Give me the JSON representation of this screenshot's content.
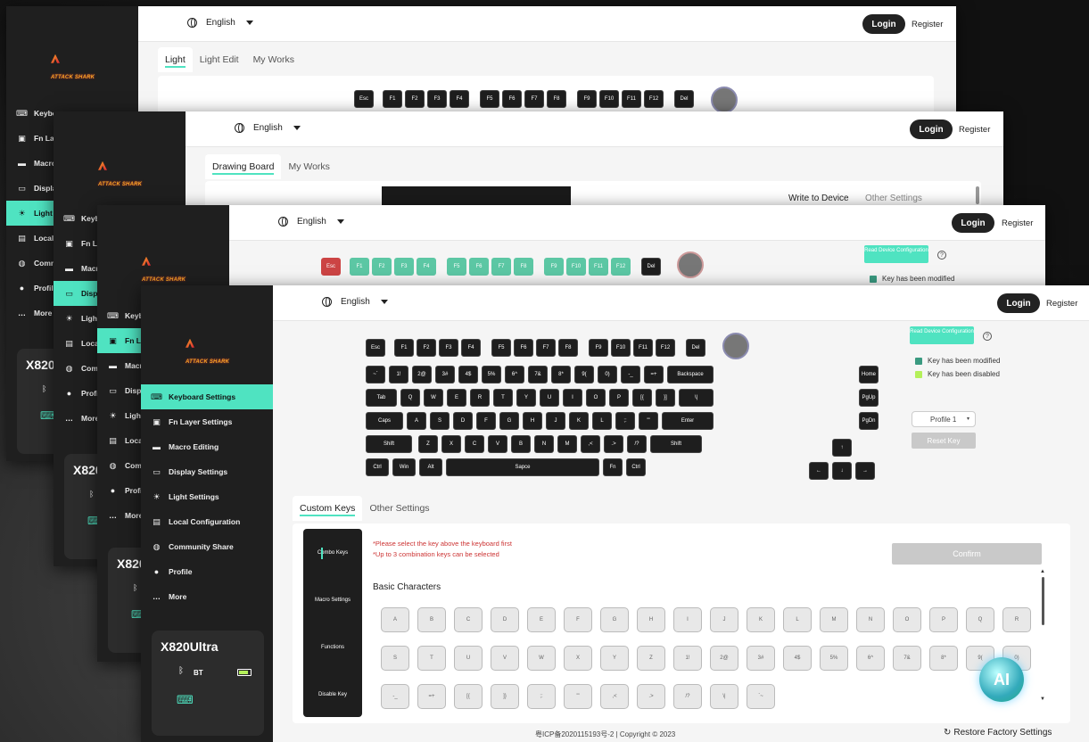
{
  "app": {
    "logo_text": "ATTACK SHARK",
    "language": "English",
    "login_label": "Login",
    "register_label": "Register"
  },
  "window1": {
    "tabs": [
      {
        "label": "Light"
      },
      {
        "label": "Light Edit"
      },
      {
        "label": "My Works"
      }
    ]
  },
  "window2": {
    "tabs": [
      {
        "label": "Drawing Board"
      },
      {
        "label": "My Works"
      }
    ],
    "actions": {
      "write": "Write to Device",
      "other": "Other Settings"
    }
  },
  "sidebar": {
    "items": [
      {
        "label": "Keyboard Settings",
        "icon": "keyboard-icon"
      },
      {
        "label": "Fn Layer Settings",
        "icon": "fn-icon"
      },
      {
        "label": "Macro Editing",
        "icon": "macro-icon"
      },
      {
        "label": "Display Settings",
        "icon": "display-icon"
      },
      {
        "label": "Light Settings",
        "icon": "light-icon"
      },
      {
        "label": "Local Configuration",
        "icon": "local-config-icon"
      },
      {
        "label": "Community Share",
        "icon": "community-icon"
      },
      {
        "label": "Profile",
        "icon": "profile-icon"
      },
      {
        "label": "More",
        "icon": "more-icon"
      }
    ],
    "partial_labels": [
      "Keybo",
      "Fn Lay",
      "Macro",
      "Displa",
      "Light S",
      "Local",
      "Comm",
      "Profile",
      "More"
    ],
    "partial_labels_2": [
      "Keyb",
      "Fn La",
      "Macro",
      "Disp",
      "Light",
      "Local",
      "Comm",
      "Profil",
      "More"
    ],
    "partial_labels_3": [
      "Keyb",
      "Fn La",
      "Macr",
      "Displ",
      "Light",
      "Loca",
      "Comi",
      "Profi",
      "More"
    ]
  },
  "device": {
    "name": "X820Ultra",
    "short_name": "X820",
    "connection": "BT",
    "connection_short": "B"
  },
  "keyboard": {
    "row1": [
      "Esc",
      "F1",
      "F2",
      "F3",
      "F4",
      "F5",
      "F6",
      "F7",
      "F8",
      "F9",
      "F10",
      "F11",
      "F12",
      "Del"
    ],
    "row2": [
      "~`",
      "1!",
      "2@",
      "3#",
      "4$",
      "5%",
      "6^",
      "7&",
      "8*",
      "9(",
      "0)",
      "-_",
      "=+",
      "Backspace",
      "Home"
    ],
    "row3": [
      "Tab",
      "Q",
      "W",
      "E",
      "R",
      "T",
      "Y",
      "U",
      "I",
      "O",
      "P",
      "[{",
      "}]",
      "\\|",
      "PgUp"
    ],
    "row4": [
      "Caps",
      "A",
      "S",
      "D",
      "F",
      "G",
      "H",
      "J",
      "K",
      "L",
      ";:",
      "'\"",
      "Enter",
      "PgDn"
    ],
    "row5": [
      "Shift",
      "Z",
      "X",
      "C",
      "V",
      "B",
      "N",
      "M",
      ",<",
      ".>",
      "/?",
      "Shift",
      "↑"
    ],
    "row6": [
      "Ctrl",
      "Win",
      "Alt",
      "Sapce",
      "Fn",
      "Ctrl",
      "←",
      "↓",
      "→"
    ]
  },
  "right_panel": {
    "read_config": "Read Device Configuration",
    "legend_modified": "Key has been modified",
    "legend_disabled": "Key has been disabled",
    "profile": "Profile 1",
    "reset": "Reset Key",
    "colors": {
      "modified": "#3a9a80",
      "disabled": "#b4f05a",
      "accent": "#4fe3c1"
    }
  },
  "lower": {
    "tabs": [
      {
        "label": "Custom Keys"
      },
      {
        "label": "Other Settings"
      }
    ],
    "side_tabs": [
      "Combo Keys",
      "Macro Settings",
      "Functions",
      "Disable Key"
    ],
    "hint1": "*Please select the key above the keyboard first",
    "hint2": "*Up to 3 combination keys can be selected",
    "confirm": "Confirm",
    "section_title": "Basic Characters",
    "row_a": [
      "A",
      "B",
      "C",
      "D",
      "E",
      "F",
      "G",
      "H",
      "I",
      "J",
      "K",
      "L",
      "M",
      "N",
      "O",
      "P",
      "Q",
      "R"
    ],
    "row_b": [
      "S",
      "T",
      "U",
      "V",
      "W",
      "X",
      "Y",
      "Z",
      "1!",
      "2@",
      "3#",
      "4$",
      "5%",
      "6^",
      "7&",
      "8*",
      "9(",
      "0)"
    ],
    "row_c": [
      "-_",
      "=+",
      "[{",
      "]}",
      ";:",
      "'\"",
      ",<",
      ".>",
      "/?",
      "\\|",
      "`~"
    ]
  },
  "footer": {
    "icp": "粤ICP备2020115193号-2 | Copyright © 2023",
    "restore": "Restore Factory Settings"
  },
  "ai_badge": "AI"
}
